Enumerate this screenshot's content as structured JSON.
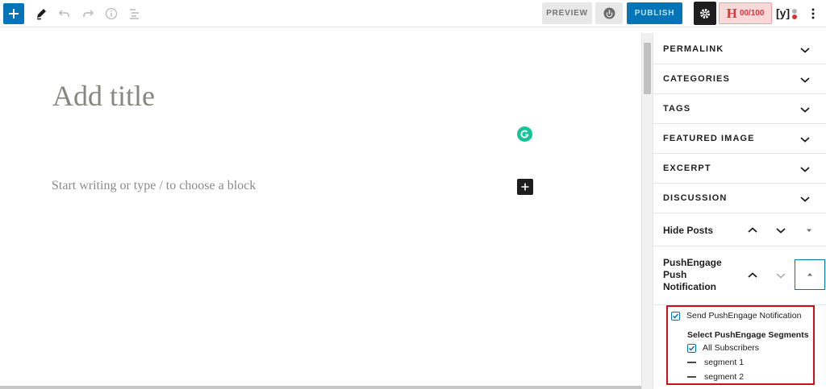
{
  "toolbar": {
    "preview_label": "PREVIEW",
    "publish_label": "PUBLISH",
    "score_label": "00/100",
    "score_letter": "H",
    "yoast_label": "[y]"
  },
  "editor": {
    "title_placeholder": "Add title",
    "block_placeholder": "Start writing or type / to choose a block"
  },
  "sidebar": {
    "panels": [
      {
        "label": "PERMALINK"
      },
      {
        "label": "CATEGORIES"
      },
      {
        "label": "TAGS"
      },
      {
        "label": "FEATURED IMAGE"
      },
      {
        "label": "EXCERPT"
      },
      {
        "label": "DISCUSSION"
      }
    ],
    "hide_posts": {
      "label": "Hide Posts"
    },
    "pushengage": {
      "label": "PushEngage Push Notification",
      "send_label": "Send PushEngage Notification",
      "send_checked": true,
      "segments_heading": "Select PushEngage Segments",
      "segments": [
        {
          "label": "All Subscribers",
          "state": "checked"
        },
        {
          "label": "segment 1",
          "state": "dash"
        },
        {
          "label": "segment 2",
          "state": "dash"
        }
      ]
    }
  },
  "colors": {
    "accent": "#0275b8",
    "highlight_box": "#d10f1a",
    "grammarly": "#15c39a",
    "score_bg": "#fbd9d9"
  }
}
